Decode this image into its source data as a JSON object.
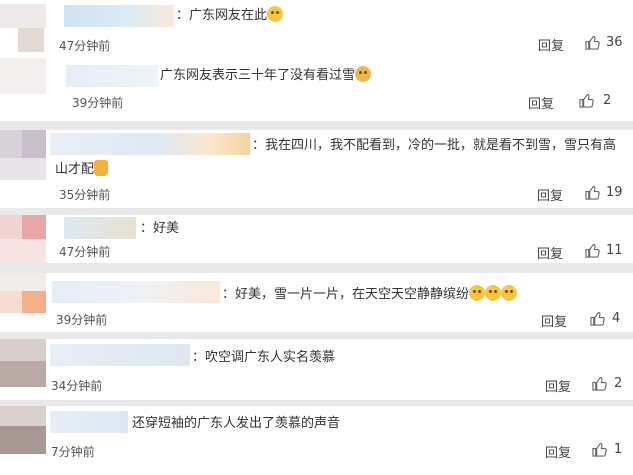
{
  "reply_label": "回复",
  "comments": [
    {
      "text": "：广东网友在此",
      "emoji": "smile-emoji",
      "time": "47分钟前",
      "likes": "36"
    },
    {
      "text": "广东网友表示三十年了没有看过雪",
      "emoji": "shocked-emoji",
      "time": "39分钟前",
      "likes": "2"
    },
    {
      "text1": "：我在四川，我不配看到，冷的一批，就是看不到雪，雪只有高",
      "text2": "山才配",
      "emoji": "thumbs-up-emoji",
      "time": "35分钟前",
      "likes": "19"
    },
    {
      "text": "：好美",
      "time": "47分钟前",
      "likes": "11"
    },
    {
      "text": "：好美，雪一片一片，在天空天空静静缤纷",
      "emoji": "laugh-emoji-x3",
      "time": "39分钟前",
      "likes": "4"
    },
    {
      "text": "：吹空调广东人实名羡慕",
      "time": "34分钟前",
      "likes": "2"
    },
    {
      "text": "还穿短袖的广东人发出了羡慕的声音",
      "time": "7分钟前",
      "likes": "1"
    }
  ],
  "colors": {
    "background": "#f2f2f2",
    "card": "#ffffff",
    "text": "#333333",
    "meta": "#555555"
  }
}
